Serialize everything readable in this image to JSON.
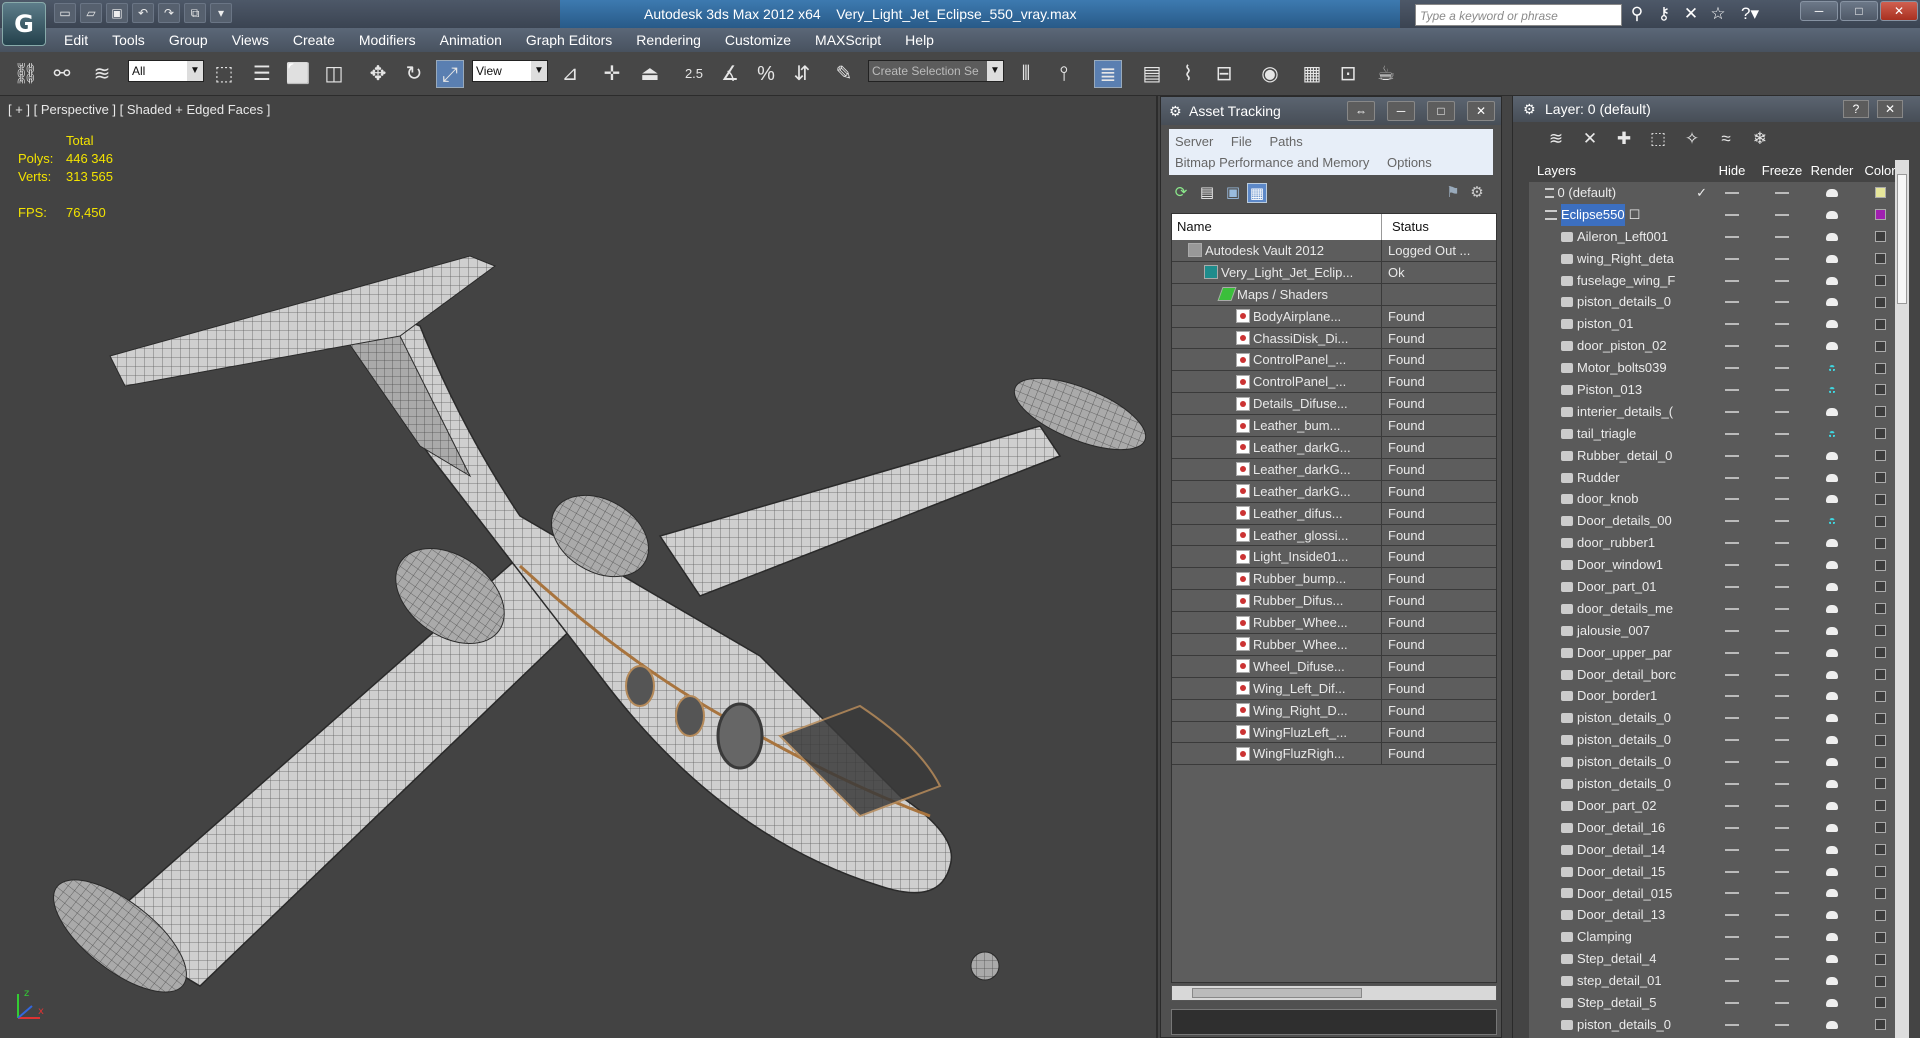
{
  "title_bar": {
    "app_title": "Autodesk 3ds Max  2012 x64",
    "file_name": "Very_Light_Jet_Eclipse_550_vray.max",
    "search_placeholder": "Type a keyword or phrase",
    "quick_access_icons": [
      "new-icon",
      "open-icon",
      "save-icon",
      "undo-icon",
      "redo-icon",
      "project-icon",
      "dropdown-icon"
    ]
  },
  "menu": [
    "Edit",
    "Tools",
    "Group",
    "Views",
    "Create",
    "Modifiers",
    "Animation",
    "Graph Editors",
    "Rendering",
    "Customize",
    "MAXScript",
    "Help"
  ],
  "toolbar": {
    "selection_filter": "All",
    "reference_coord": "View",
    "snap_value": "2.5",
    "named_selection_placeholder": "Create Selection Se"
  },
  "viewport": {
    "label": "[ + ] [ Perspective ] [ Shaded + Edged Faces ]",
    "stats": {
      "total_label": "Total",
      "polys_label": "Polys:",
      "polys": "446 346",
      "verts_label": "Verts:",
      "verts": "313 565",
      "fps_label": "FPS:",
      "fps": "76,450"
    },
    "axis_z": "z",
    "axis_x": "x"
  },
  "asset_tracking": {
    "title": "Asset Tracking",
    "menu_row1": [
      "Server",
      "File",
      "Paths"
    ],
    "menu_row2": [
      "Bitmap Performance and Memory",
      "Options"
    ],
    "col_name": "Name",
    "col_status": "Status",
    "rows": [
      {
        "name": "Autodesk Vault 2012",
        "status": "Logged Out ...",
        "indent": 1,
        "icon": "vault"
      },
      {
        "name": "Very_Light_Jet_Eclip...",
        "status": "Ok",
        "indent": 2,
        "icon": "max"
      },
      {
        "name": "Maps / Shaders",
        "status": "",
        "indent": 3,
        "icon": "folder"
      },
      {
        "name": "BodyAirplane...",
        "status": "Found",
        "indent": 4,
        "icon": "map"
      },
      {
        "name": "ChassiDisk_Di...",
        "status": "Found",
        "indent": 4,
        "icon": "map"
      },
      {
        "name": "ControlPanel_...",
        "status": "Found",
        "indent": 4,
        "icon": "map"
      },
      {
        "name": "ControlPanel_...",
        "status": "Found",
        "indent": 4,
        "icon": "map"
      },
      {
        "name": "Details_Difuse...",
        "status": "Found",
        "indent": 4,
        "icon": "map"
      },
      {
        "name": "Leather_bum...",
        "status": "Found",
        "indent": 4,
        "icon": "map"
      },
      {
        "name": "Leather_darkG...",
        "status": "Found",
        "indent": 4,
        "icon": "map"
      },
      {
        "name": "Leather_darkG...",
        "status": "Found",
        "indent": 4,
        "icon": "map"
      },
      {
        "name": "Leather_darkG...",
        "status": "Found",
        "indent": 4,
        "icon": "map"
      },
      {
        "name": "Leather_difus...",
        "status": "Found",
        "indent": 4,
        "icon": "map"
      },
      {
        "name": "Leather_glossi...",
        "status": "Found",
        "indent": 4,
        "icon": "map"
      },
      {
        "name": "Light_Inside01...",
        "status": "Found",
        "indent": 4,
        "icon": "map"
      },
      {
        "name": "Rubber_bump...",
        "status": "Found",
        "indent": 4,
        "icon": "map"
      },
      {
        "name": "Rubber_Difus...",
        "status": "Found",
        "indent": 4,
        "icon": "map"
      },
      {
        "name": "Rubber_Whee...",
        "status": "Found",
        "indent": 4,
        "icon": "map"
      },
      {
        "name": "Rubber_Whee...",
        "status": "Found",
        "indent": 4,
        "icon": "map"
      },
      {
        "name": "Wheel_Difuse...",
        "status": "Found",
        "indent": 4,
        "icon": "map"
      },
      {
        "name": "Wing_Left_Dif...",
        "status": "Found",
        "indent": 4,
        "icon": "map"
      },
      {
        "name": "Wing_Right_D...",
        "status": "Found",
        "indent": 4,
        "icon": "map"
      },
      {
        "name": "WingFluzLeft_...",
        "status": "Found",
        "indent": 4,
        "icon": "map"
      },
      {
        "name": "WingFluzRigh...",
        "status": "Found",
        "indent": 4,
        "icon": "map"
      }
    ]
  },
  "layers": {
    "title": "Layer: 0 (default)",
    "help_label": "?",
    "columns": [
      "Layers",
      "Hide",
      "Freeze",
      "Render",
      "Color"
    ],
    "rows": [
      {
        "name": "0 (default)",
        "kind": "layer",
        "current": true,
        "render": "teapot",
        "color": "#e6e69a"
      },
      {
        "name": "Eclipse550",
        "kind": "layer",
        "selected": true,
        "render": "teapot",
        "color": "#a020b0"
      },
      {
        "name": "Aileron_Left001",
        "kind": "object",
        "render": "teapot"
      },
      {
        "name": "wing_Right_deta",
        "kind": "object",
        "render": "teapot"
      },
      {
        "name": "fuselage_wing_F",
        "kind": "object",
        "render": "teapot"
      },
      {
        "name": "piston_details_0",
        "kind": "object",
        "render": "teapot"
      },
      {
        "name": "piston_01",
        "kind": "object",
        "render": "teapot"
      },
      {
        "name": "door_piston_02",
        "kind": "object",
        "render": "teapot"
      },
      {
        "name": "Motor_bolts039",
        "kind": "object",
        "render": "cyan"
      },
      {
        "name": "Piston_013",
        "kind": "object",
        "render": "cyan"
      },
      {
        "name": "interier_details_(",
        "kind": "object",
        "render": "teapot"
      },
      {
        "name": "tail_triagle",
        "kind": "object",
        "render": "cyan"
      },
      {
        "name": "Rubber_detail_0",
        "kind": "object",
        "render": "teapot"
      },
      {
        "name": "Rudder",
        "kind": "object",
        "render": "teapot"
      },
      {
        "name": "door_knob",
        "kind": "object",
        "render": "teapot"
      },
      {
        "name": "Door_details_00",
        "kind": "object",
        "render": "cyan"
      },
      {
        "name": "door_rubber1",
        "kind": "object",
        "render": "teapot"
      },
      {
        "name": "Door_window1",
        "kind": "object",
        "render": "teapot"
      },
      {
        "name": "Door_part_01",
        "kind": "object",
        "render": "teapot"
      },
      {
        "name": "door_details_me",
        "kind": "object",
        "render": "teapot"
      },
      {
        "name": "jalousie_007",
        "kind": "object",
        "render": "teapot"
      },
      {
        "name": "Door_upper_par",
        "kind": "object",
        "render": "teapot"
      },
      {
        "name": "Door_detail_borc",
        "kind": "object",
        "render": "teapot"
      },
      {
        "name": "Door_border1",
        "kind": "object",
        "render": "teapot"
      },
      {
        "name": "piston_details_0",
        "kind": "object",
        "render": "teapot"
      },
      {
        "name": "piston_details_0",
        "kind": "object",
        "render": "teapot"
      },
      {
        "name": "piston_details_0",
        "kind": "object",
        "render": "teapot"
      },
      {
        "name": "piston_details_0",
        "kind": "object",
        "render": "teapot"
      },
      {
        "name": "Door_part_02",
        "kind": "object",
        "render": "teapot"
      },
      {
        "name": "Door_detail_16",
        "kind": "object",
        "render": "teapot"
      },
      {
        "name": "Door_detail_14",
        "kind": "object",
        "render": "teapot"
      },
      {
        "name": "Door_detail_15",
        "kind": "object",
        "render": "teapot"
      },
      {
        "name": "Door_detail_015",
        "kind": "object",
        "render": "teapot"
      },
      {
        "name": "Door_detail_13",
        "kind": "object",
        "render": "teapot"
      },
      {
        "name": "Clamping",
        "kind": "object",
        "render": "teapot"
      },
      {
        "name": "Step_detail_4",
        "kind": "object",
        "render": "teapot"
      },
      {
        "name": "step_detail_01",
        "kind": "object",
        "render": "teapot"
      },
      {
        "name": "Step_detail_5",
        "kind": "object",
        "render": "teapot"
      },
      {
        "name": "piston_details_0",
        "kind": "object",
        "render": "teapot"
      }
    ]
  },
  "colors": {
    "title_accent": "#285a88",
    "stats_yellow": "#f3e300",
    "selection_blue": "#3c6fc0",
    "viewport_bg": "#434343"
  }
}
